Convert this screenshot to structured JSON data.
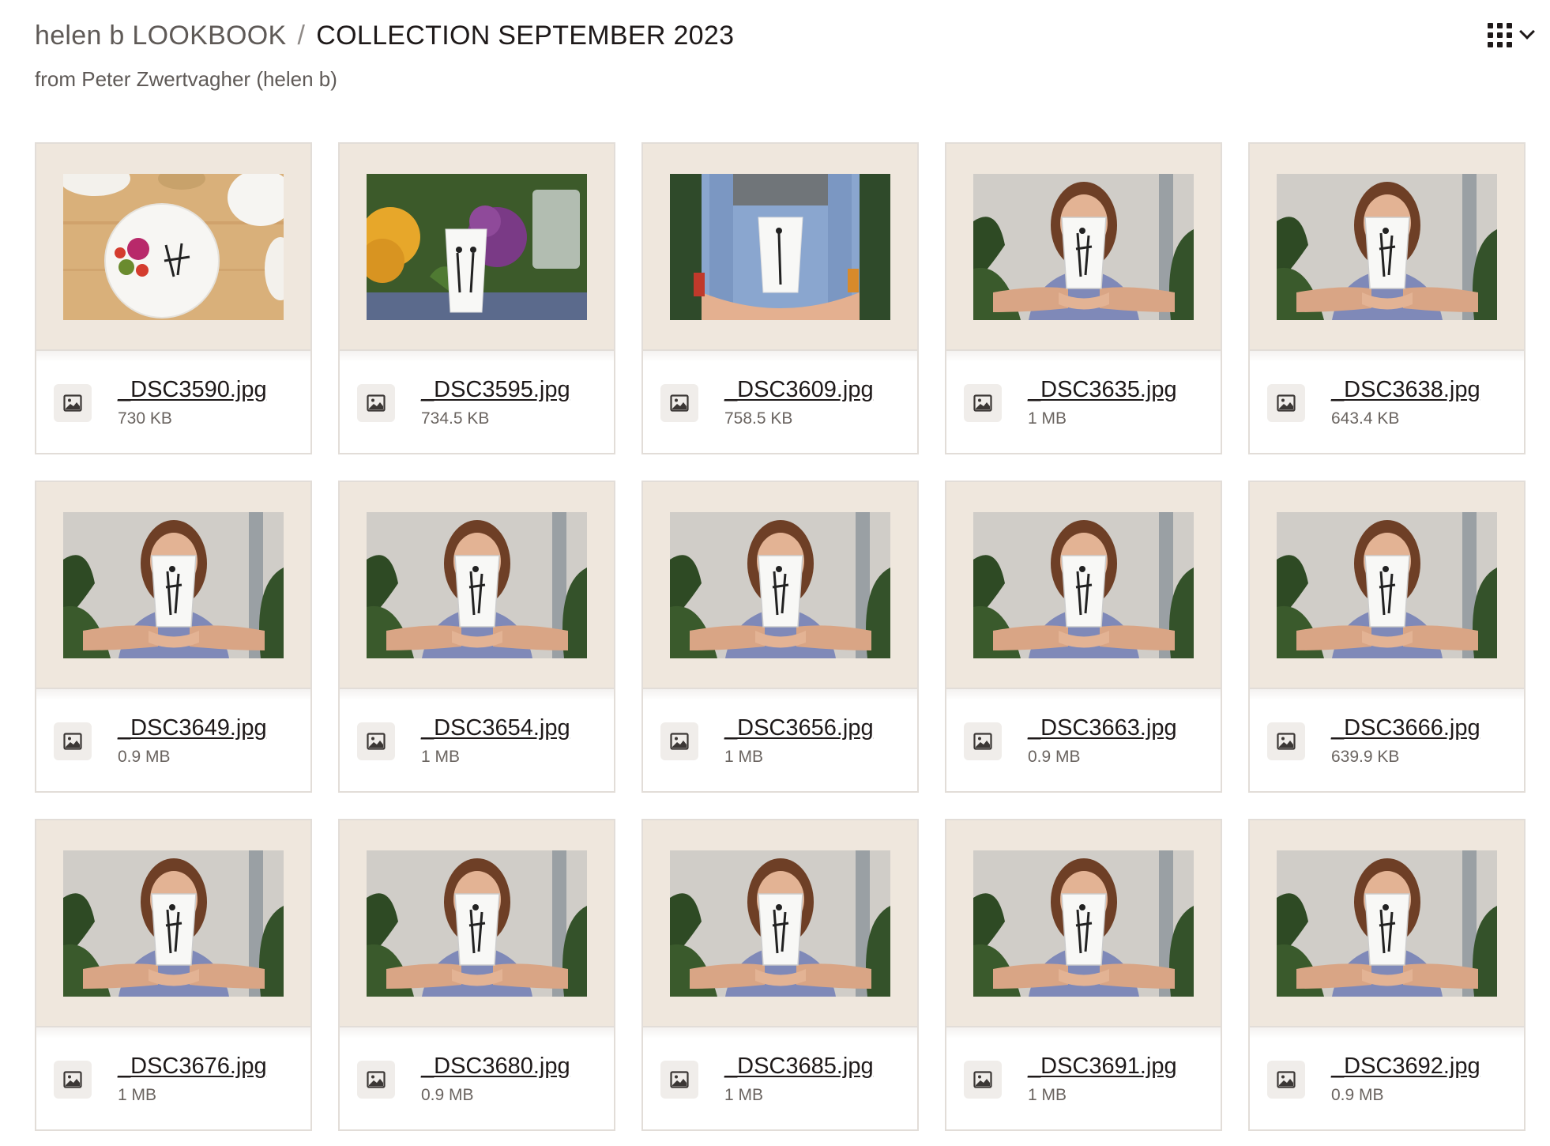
{
  "header": {
    "breadcrumb_parent": "helen b LOOKBOOK",
    "breadcrumb_separator": "/",
    "title": "COLLECTION SEPTEMBER 2023",
    "subtitle": "from Peter Zwertvagher (helen b)"
  },
  "view_toggle": {
    "icon": "grid-view-icon",
    "dropdown_icon": "chevron-down-icon"
  },
  "colors": {
    "card_background": "#efe7dd",
    "card_border": "#e2ddd8",
    "text": "#1e1919",
    "muted": "#6a6460"
  },
  "files": [
    {
      "name": "_DSC3590.jpg",
      "size": "730 KB",
      "scene": "plate",
      "icon": "image-file-icon"
    },
    {
      "name": "_DSC3595.jpg",
      "size": "734.5 KB",
      "scene": "veggies",
      "icon": "image-file-icon"
    },
    {
      "name": "_DSC3609.jpg",
      "size": "758.5 KB",
      "scene": "overalls",
      "icon": "image-file-icon"
    },
    {
      "name": "_DSC3635.jpg",
      "size": "1 MB",
      "scene": "girl",
      "icon": "image-file-icon"
    },
    {
      "name": "_DSC3638.jpg",
      "size": "643.4 KB",
      "scene": "girl",
      "icon": "image-file-icon"
    },
    {
      "name": "_DSC3649.jpg",
      "size": "0.9 MB",
      "scene": "girl",
      "icon": "image-file-icon"
    },
    {
      "name": "_DSC3654.jpg",
      "size": "1 MB",
      "scene": "girl",
      "icon": "image-file-icon"
    },
    {
      "name": "_DSC3656.jpg",
      "size": "1 MB",
      "scene": "girl",
      "icon": "image-file-icon"
    },
    {
      "name": "_DSC3663.jpg",
      "size": "0.9 MB",
      "scene": "girl",
      "icon": "image-file-icon"
    },
    {
      "name": "_DSC3666.jpg",
      "size": "639.9 KB",
      "scene": "girl",
      "icon": "image-file-icon"
    },
    {
      "name": "_DSC3676.jpg",
      "size": "1 MB",
      "scene": "girl",
      "icon": "image-file-icon"
    },
    {
      "name": "_DSC3680.jpg",
      "size": "0.9 MB",
      "scene": "girl",
      "icon": "image-file-icon"
    },
    {
      "name": "_DSC3685.jpg",
      "size": "1 MB",
      "scene": "girl",
      "icon": "image-file-icon"
    },
    {
      "name": "_DSC3691.jpg",
      "size": "1 MB",
      "scene": "girl",
      "icon": "image-file-icon"
    },
    {
      "name": "_DSC3692.jpg",
      "size": "0.9 MB",
      "scene": "girl",
      "icon": "image-file-icon"
    }
  ]
}
